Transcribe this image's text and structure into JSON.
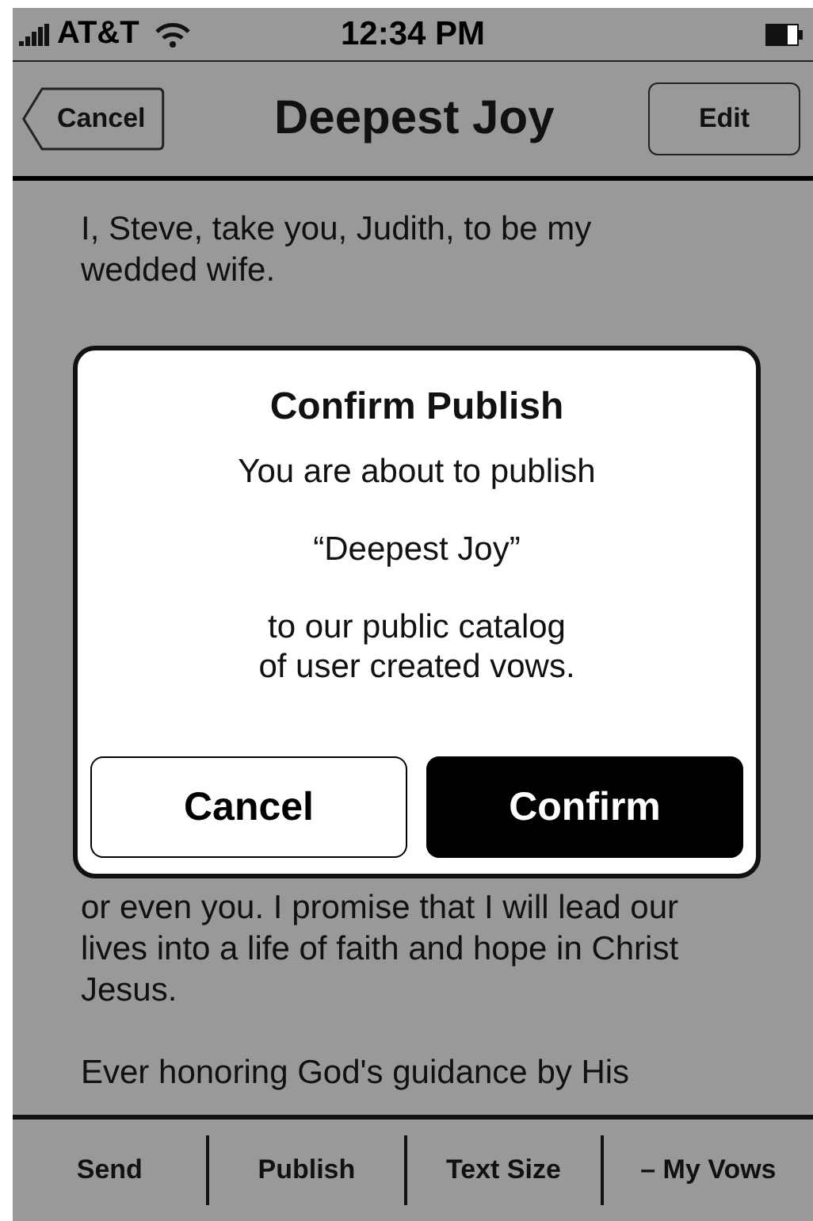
{
  "status_bar": {
    "carrier": "AT&T",
    "time": "12:34 PM"
  },
  "nav_bar": {
    "back_button": "Cancel",
    "title": "Deepest Joy",
    "edit_button": "Edit"
  },
  "content": {
    "paragraphs": [
      "I, Steve, take you, Judith, to be my wedded wife.",
      "or even you. I promise that I will lead our lives into a life of faith and hope in Christ Jesus.",
      "Ever honoring God's guidance by His"
    ]
  },
  "dialog": {
    "title": "Confirm Publish",
    "lines": [
      "You are about to publish",
      "“Deepest Joy”",
      "to our public catalog\nof user created vows."
    ],
    "buttons": [
      {
        "label": "Cancel",
        "kind": "secondary"
      },
      {
        "label": "Confirm",
        "kind": "primary"
      }
    ]
  },
  "toolbar": {
    "items": [
      "Send",
      "Publish",
      "Text Size",
      "– My Vows"
    ]
  }
}
